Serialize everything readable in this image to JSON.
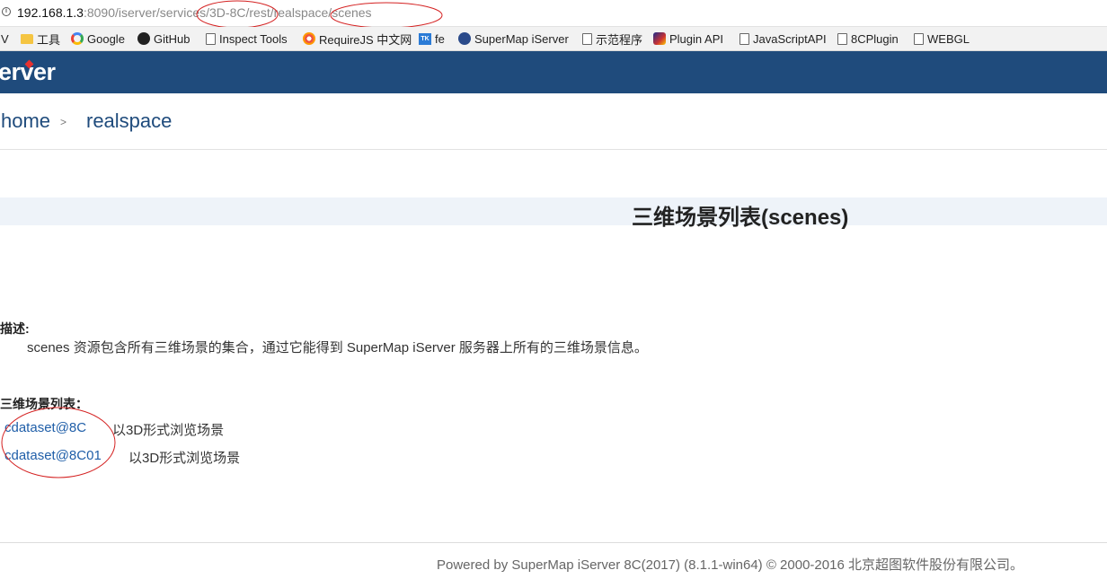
{
  "browser": {
    "url_host": "192.168.1.3",
    "url_rest": ":8090/iserver/services/3D-8C/rest/realspace/scenes",
    "bookmarks": [
      {
        "label": "V",
        "icon": "none"
      },
      {
        "label": "工具",
        "icon": "folder-icon"
      },
      {
        "label": "Google",
        "icon": "google-icon"
      },
      {
        "label": "GitHub",
        "icon": "github-icon"
      },
      {
        "label": "Inspect Tools",
        "icon": "page-icon"
      },
      {
        "label": "RequireJS 中文网",
        "icon": "requirejs-icon"
      },
      {
        "label": "fe",
        "icon": "tk-icon"
      },
      {
        "label": "SuperMap iServer",
        "icon": "supermap-icon"
      },
      {
        "label": "示范程序",
        "icon": "page-icon"
      },
      {
        "label": "Plugin API",
        "icon": "plugin-icon"
      },
      {
        "label": "JavaScriptAPI",
        "icon": "page-icon"
      },
      {
        "label": "8CPlugin",
        "icon": "page-icon"
      },
      {
        "label": "WEBGL",
        "icon": "page-icon"
      }
    ]
  },
  "header": {
    "logo": "erver",
    "color": "#1f4b7c"
  },
  "breadcrumb": {
    "home": "home",
    "separator": ">",
    "current": "realspace"
  },
  "page": {
    "title": "三维场景列表(scenes)",
    "description_label": "描述:",
    "description_text": "scenes 资源包含所有三维场景的集合，通过它能得到 SuperMap iServer 服务器上所有的三维场景信息。",
    "list_label": "三维场景列表："
  },
  "scenes": [
    {
      "name": "cdataset@8C",
      "view_label": "以3D形式浏览场景"
    },
    {
      "name": "cdataset@8C01",
      "view_label": "以3D形式浏览场景"
    }
  ],
  "footer": {
    "text": "Powered by SuperMap iServer 8C(2017) (8.1.1-win64) © 2000-2016 北京超图软件股份有限公司。"
  },
  "annotation_color": "#d42020"
}
